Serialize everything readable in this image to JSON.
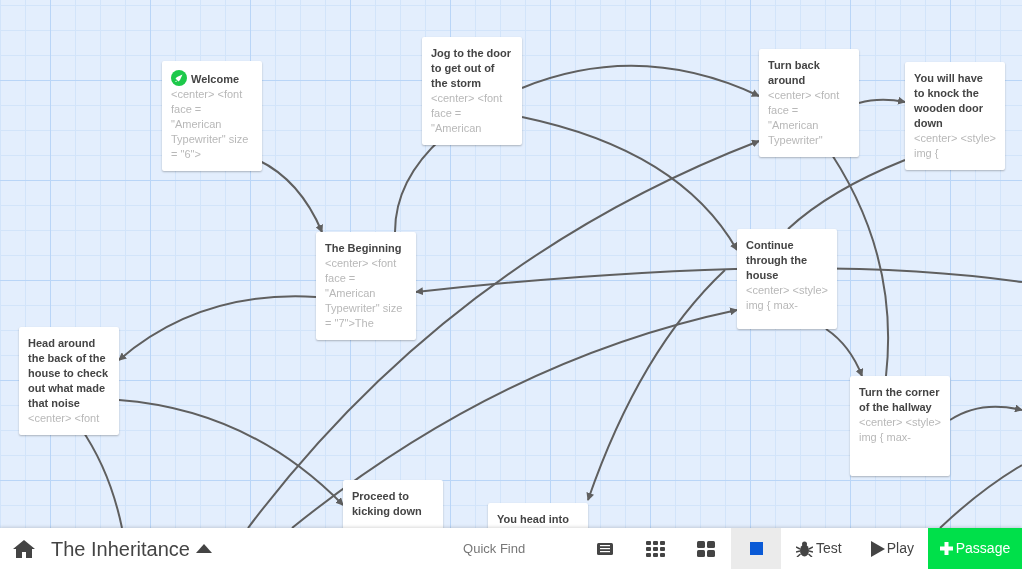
{
  "passages": [
    {
      "title": "Welcome",
      "excerpt": "<center> <font face = \"American Typewriter\" size = \"6\">",
      "start": true
    },
    {
      "title": "Jog to the door to get out of the storm",
      "excerpt": "<center> <font face = \"American",
      "start": false
    },
    {
      "title": "Turn back around",
      "excerpt": "<center> <font face = \"American Typewriter\"",
      "start": false
    },
    {
      "title": "You will have to knock the wooden door down",
      "excerpt": "<center> <style> img {",
      "start": false
    },
    {
      "title": "The Beginning",
      "excerpt": "<center> <font face = \"American Typewriter\" size = \"7\">The",
      "start": false
    },
    {
      "title": "Continue through the house",
      "excerpt": "<center> <style> img { max-",
      "start": false
    },
    {
      "title": "Head around the back of the house to check out what made that noise",
      "excerpt": "<center> <font",
      "start": false
    },
    {
      "title": "Turn the corner of the hallway",
      "excerpt": "<center> <style> img { max-",
      "start": false
    },
    {
      "title": "Proceed to kicking down",
      "start": false
    },
    {
      "title": "You head into",
      "start": false
    }
  ],
  "toolbar": {
    "story_title": "The Inheritance",
    "quick_find": {
      "placeholder": "Quick Find"
    },
    "zoom_buttons": [
      {
        "selected": false
      },
      {
        "selected": false
      },
      {
        "selected": true
      }
    ],
    "test": "Test",
    "play": "Play",
    "add_passage": "Passage"
  }
}
